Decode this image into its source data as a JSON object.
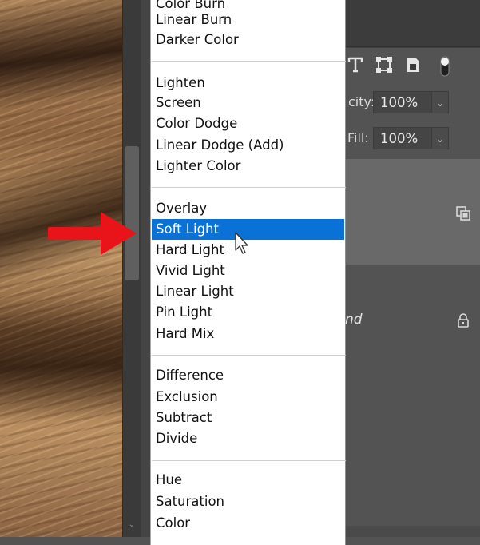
{
  "menu": {
    "groups": [
      {
        "items": [
          {
            "label": "Color Burn"
          },
          {
            "label": "Linear Burn"
          },
          {
            "label": "Darker Color"
          }
        ]
      },
      {
        "items": [
          {
            "label": "Lighten"
          },
          {
            "label": "Screen"
          },
          {
            "label": "Color Dodge"
          },
          {
            "label": "Linear Dodge (Add)"
          },
          {
            "label": "Lighter Color"
          }
        ]
      },
      {
        "items": [
          {
            "label": "Overlay"
          },
          {
            "label": "Soft Light"
          },
          {
            "label": "Hard Light"
          },
          {
            "label": "Vivid Light"
          },
          {
            "label": "Linear Light"
          },
          {
            "label": "Pin Light"
          },
          {
            "label": "Hard Mix"
          }
        ]
      },
      {
        "items": [
          {
            "label": "Difference"
          },
          {
            "label": "Exclusion"
          },
          {
            "label": "Subtract"
          },
          {
            "label": "Divide"
          }
        ]
      },
      {
        "items": [
          {
            "label": "Hue"
          },
          {
            "label": "Saturation"
          },
          {
            "label": "Color"
          }
        ]
      }
    ],
    "selected": "Soft Light"
  },
  "layers_panel": {
    "opacity_label_fragment": "city:",
    "opacity_value": "100%",
    "fill_label": "Fill:",
    "fill_value": "100%",
    "background_layer_name_fragment": "nd",
    "filter_icons": [
      "type-icon",
      "transform-icon",
      "smart-object-icon",
      "toggle-icon"
    ]
  },
  "annotation": {
    "arrow_color": "#e8141a"
  },
  "colors": {
    "selection": "#0a72d6",
    "panel": "#535353"
  }
}
